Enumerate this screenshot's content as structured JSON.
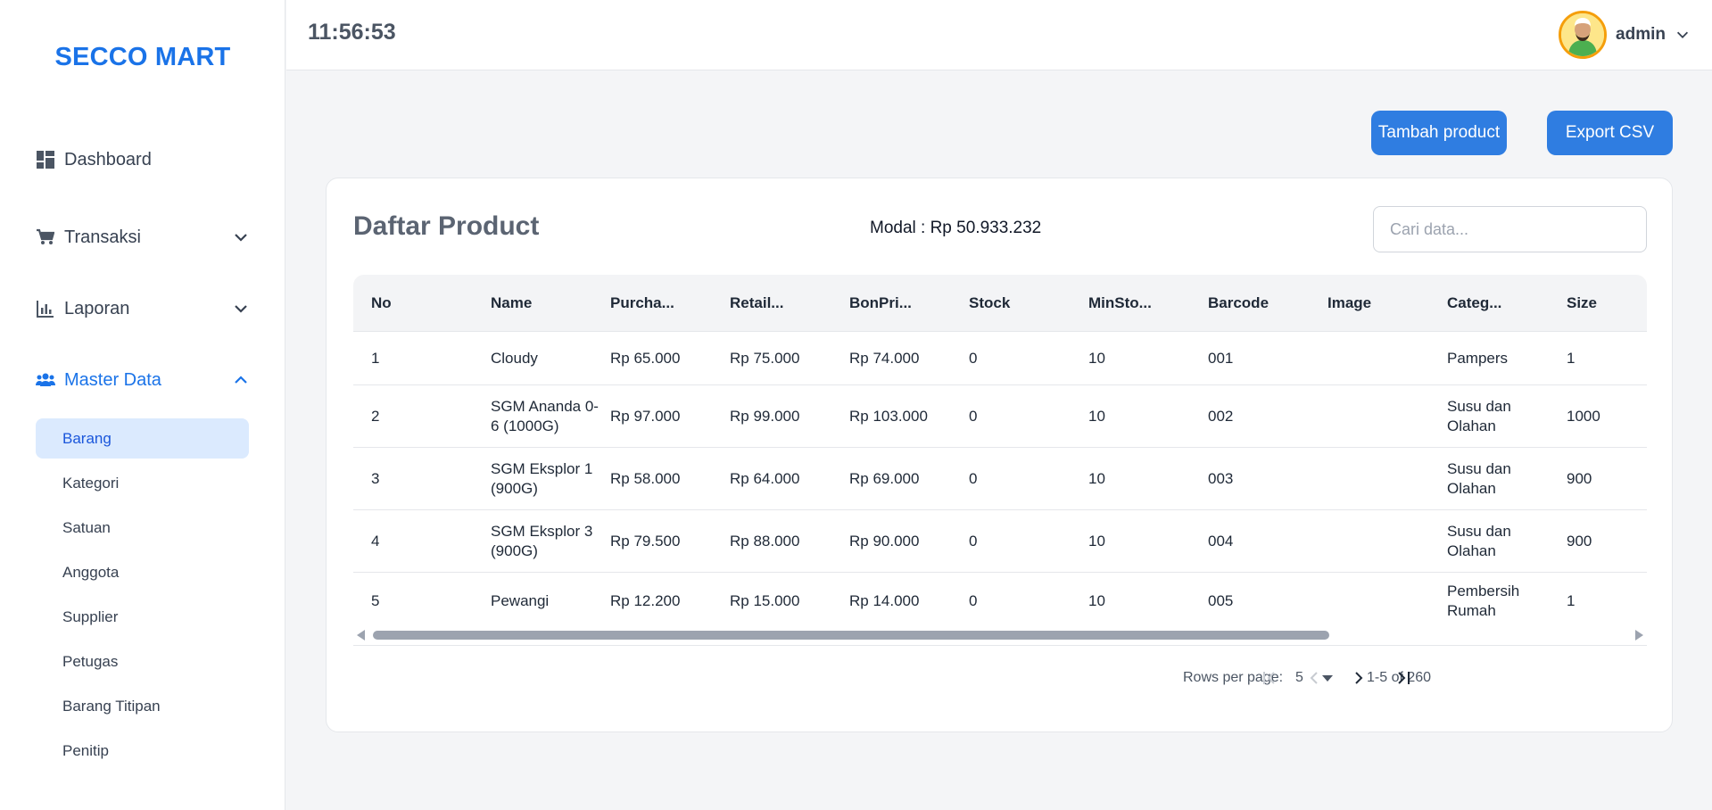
{
  "brand": {
    "name": "SECCO MART"
  },
  "header": {
    "time": "11:56:53",
    "username": "admin"
  },
  "sidebar": {
    "items": [
      {
        "label": "Dashboard",
        "icon": "dashboard-icon"
      },
      {
        "label": "Transaksi",
        "icon": "cart-icon"
      },
      {
        "label": "Laporan",
        "icon": "chart-icon"
      },
      {
        "label": "Master Data",
        "icon": "users-icon"
      }
    ],
    "master_sub": [
      {
        "label": "Barang"
      },
      {
        "label": "Kategori"
      },
      {
        "label": "Satuan"
      },
      {
        "label": "Anggota"
      },
      {
        "label": "Supplier"
      },
      {
        "label": "Petugas"
      },
      {
        "label": "Barang Titipan"
      },
      {
        "label": "Penitip"
      }
    ]
  },
  "actions": {
    "add_label": "Tambah product",
    "export_label": "Export CSV"
  },
  "card": {
    "title": "Daftar Product",
    "modal": "Modal : Rp 50.933.232",
    "search_placeholder": "Cari data..."
  },
  "table": {
    "headers": [
      "No",
      "Name",
      "Purcha...",
      "Retail...",
      "BonPri...",
      "Stock",
      "MinSto...",
      "Barcode",
      "Image",
      "Categ...",
      "Size"
    ],
    "rows": [
      [
        "1",
        "Cloudy",
        "Rp 65.000",
        "Rp 75.000",
        "Rp 74.000",
        "0",
        "10",
        "001",
        "",
        "Pampers",
        "1"
      ],
      [
        "2",
        "SGM Ananda 0-6 (1000G)",
        "Rp 97.000",
        "Rp 99.000",
        "Rp 103.000",
        "0",
        "10",
        "002",
        "",
        "Susu dan Olahan",
        "1000"
      ],
      [
        "3",
        "SGM Eksplor 1 (900G)",
        "Rp 58.000",
        "Rp 64.000",
        "Rp 69.000",
        "0",
        "10",
        "003",
        "",
        "Susu dan Olahan",
        "900"
      ],
      [
        "4",
        "SGM Eksplor 3 (900G)",
        "Rp 79.500",
        "Rp 88.000",
        "Rp 90.000",
        "0",
        "10",
        "004",
        "",
        "Susu dan Olahan",
        "900"
      ],
      [
        "5",
        "Pewangi",
        "Rp 12.200",
        "Rp 15.000",
        "Rp 14.000",
        "0",
        "10",
        "005",
        "",
        "Pembersih Rumah",
        "1"
      ]
    ]
  },
  "pagination": {
    "rows_per_page_label": "Rows per page:",
    "rows_per_page_value": "5",
    "range": "1-5 of 260"
  },
  "colors": {
    "primary": "#2f7de1",
    "brand": "#1a73e8",
    "selected_bg": "#dbeafe"
  }
}
